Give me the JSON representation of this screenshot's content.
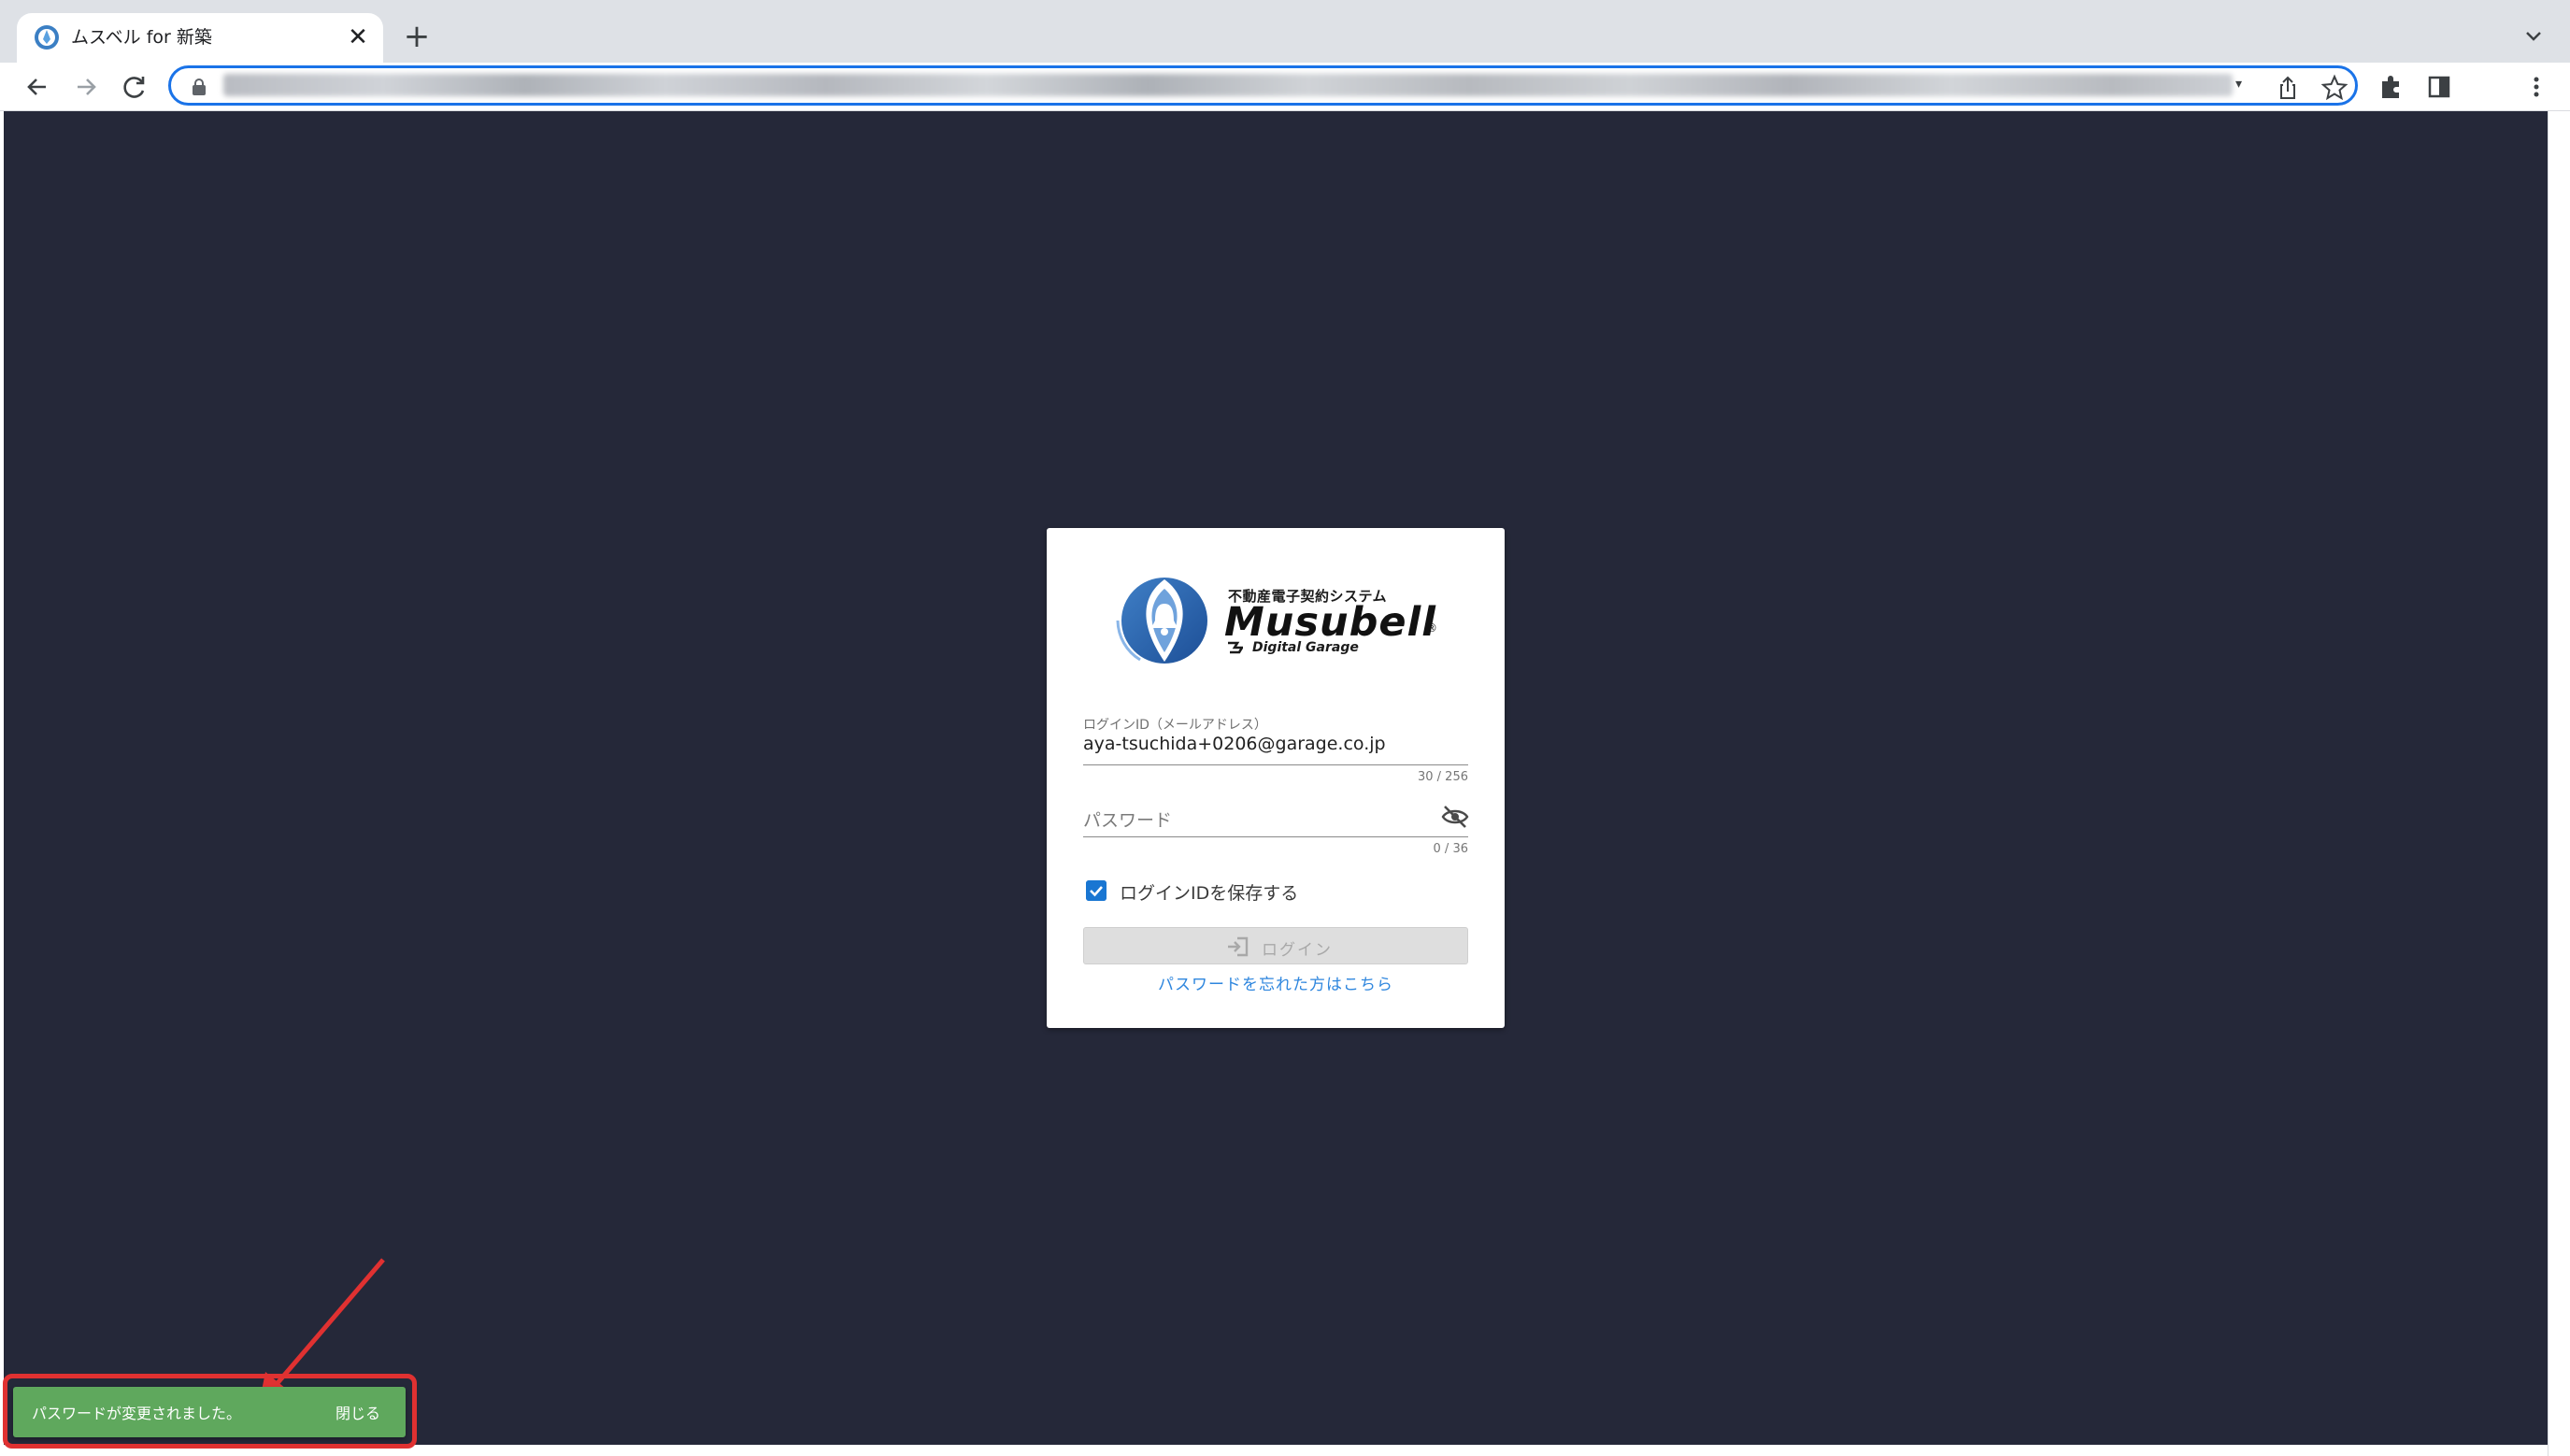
{
  "browser": {
    "tab_title": "ムスベル for 新築",
    "tab_close": "✕",
    "new_tab": "+",
    "omnibox_caret": "▾",
    "icons": [
      "favicon-icon",
      "close-icon",
      "plus-icon",
      "tab-search-icon",
      "back-icon",
      "forward-icon",
      "reload-icon",
      "lock-icon",
      "share-icon",
      "star-icon",
      "extensions-icon",
      "side-panel-icon",
      "menu-icon"
    ]
  },
  "logo": {
    "subtitle": "不動産電子契約システム",
    "name": "Musubell",
    "registered": "®",
    "company": "Digital Garage"
  },
  "login_form": {
    "id_label": "ログインID（メールアドレス）",
    "id_value": "aya-tsuchida+0206@garage.co.jp",
    "id_counter": "30 / 256",
    "password_placeholder": "パスワード",
    "password_counter": "0 / 36",
    "remember_label": "ログインIDを保存する",
    "remember_checked": true,
    "login_button": "ログイン",
    "login_enabled": false,
    "forgot_link": "パスワードを忘れた方はこちら"
  },
  "snackbar": {
    "message": "パスワードが変更されました。",
    "close_label": "閉じる",
    "color": "#5fa85d"
  },
  "colors": {
    "page_background": "#252839",
    "accent": "#1976d2",
    "link": "#2e86de",
    "annotation": "#e03131"
  }
}
